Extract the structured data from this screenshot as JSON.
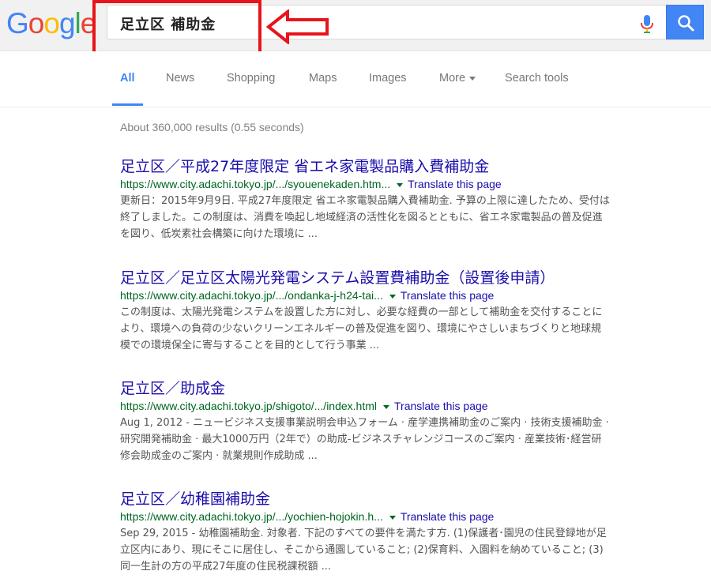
{
  "logo": {
    "letters": [
      "G",
      "o",
      "o",
      "g",
      "l",
      "e"
    ],
    "colors": [
      "#4285f4",
      "#ea4335",
      "#fbbc05",
      "#4285f4",
      "#34a853",
      "#ea4335"
    ]
  },
  "search": {
    "query": "足立区 補助金",
    "button_icon": "search-icon",
    "mic_icon": "microphone-icon"
  },
  "tabs": [
    {
      "label": "All",
      "active": true
    },
    {
      "label": "News"
    },
    {
      "label": "Shopping"
    },
    {
      "label": "Maps"
    },
    {
      "label": "Images"
    },
    {
      "label": "More"
    },
    {
      "label": "Search tools"
    }
  ],
  "stats": "About 360,000 results (0.55 seconds)",
  "translate_label": "Translate this page",
  "results": [
    {
      "title": "足立区／平成27年度限定 省エネ家電製品購入費補助金",
      "url": "https://www.city.adachi.tokyo.jp/.../syouenekaden.htm...",
      "snippet": "更新日：2015年9月9日. 平成27年度限定 省エネ家電製品購入費補助金. 予算の上限に達したため、受付は終了しました。この制度は、消費を喚起し地域経済の活性化を図るとともに、省エネ家電製品の普及促進を図り、低炭素社会構築に向けた環境に ..."
    },
    {
      "title": "足立区／足立区太陽光発電システム設置費補助金（設置後申請）",
      "url": "https://www.city.adachi.tokyo.jp/.../ondanka-j-h24-tai...",
      "snippet": "この制度は、太陽光発電システムを設置した方に対し、必要な経費の一部として補助金を交付することにより、環境への負荷の少ないクリーンエネルギーの普及促進を図り、環境にやさしいまちづくりと地球規模での環境保全に寄与することを目的として行う事業 ..."
    },
    {
      "title": "足立区／助成金",
      "url": "https://www.city.adachi.tokyo.jp/shigoto/.../index.html",
      "snippet": "Aug 1, 2012 - ニュービジネス支援事業説明会申込フォーム · 産学連携補助金のご案内 · 技術支援補助金 · 研究開発補助金 · 最大1000万円（2年で）の助成-ビジネスチャレンジコースのご案内 · 産業技術･経営研修会助成金のご案内 · 就業規則作成助成 ..."
    },
    {
      "title": "足立区／幼稚園補助金",
      "url": "https://www.city.adachi.tokyo.jp/.../yochien-hojokin.h...",
      "snippet": "Sep 29, 2015 - 幼稚園補助金. 対象者. 下記のすべての要件を満たす方. (1)保護者･園児の住民登録地が足立区内にあり、現にそこに居住し、そこから通園していること; (2)保育料、入園料を納めていること; (3)同一生計の方の平成27年度の住民税課税額 ..."
    }
  ]
}
